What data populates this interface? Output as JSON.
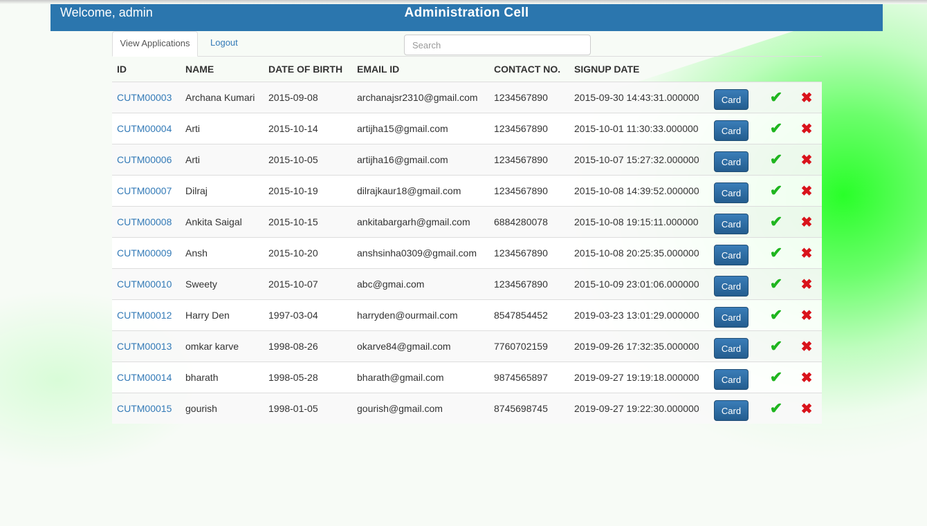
{
  "header": {
    "welcome": "Welcome, admin",
    "title": "Administration Cell",
    "color": "#2b76ae"
  },
  "tabs": [
    {
      "label": "View Applications",
      "active": true
    },
    {
      "label": "Logout",
      "active": false
    }
  ],
  "search": {
    "placeholder": "Search",
    "value": ""
  },
  "table": {
    "columns": [
      "ID",
      "NAME",
      "DATE OF BIRTH",
      "EMAIL ID",
      "CONTACT NO.",
      "SIGNUP DATE"
    ],
    "card_label": "Card",
    "approve_icon": "check-icon",
    "reject_icon": "cross-icon",
    "rows": [
      {
        "id": "CUTM00003",
        "name": "Archana Kumari",
        "dob": "2015-09-08",
        "email": "archanajsr2310@gmail.com",
        "contact": "1234567890",
        "signup": "2015-09-30 14:43:31.000000"
      },
      {
        "id": "CUTM00004",
        "name": "Arti",
        "dob": "2015-10-14",
        "email": "artijha15@gmail.com",
        "contact": "1234567890",
        "signup": "2015-10-01 11:30:33.000000"
      },
      {
        "id": "CUTM00006",
        "name": "Arti",
        "dob": "2015-10-05",
        "email": "artijha16@gmail.com",
        "contact": "1234567890",
        "signup": "2015-10-07 15:27:32.000000"
      },
      {
        "id": "CUTM00007",
        "name": "Dilraj",
        "dob": "2015-10-19",
        "email": "dilrajkaur18@gmail.com",
        "contact": "1234567890",
        "signup": "2015-10-08 14:39:52.000000"
      },
      {
        "id": "CUTM00008",
        "name": "Ankita Saigal",
        "dob": "2015-10-15",
        "email": "ankitabargarh@gmail.com",
        "contact": "6884280078",
        "signup": "2015-10-08 19:15:11.000000"
      },
      {
        "id": "CUTM00009",
        "name": "Ansh",
        "dob": "2015-10-20",
        "email": "anshsinha0309@gmail.com",
        "contact": "1234567890",
        "signup": "2015-10-08 20:25:35.000000"
      },
      {
        "id": "CUTM00010",
        "name": "Sweety",
        "dob": "2015-10-07",
        "email": "abc@gmai.com",
        "contact": "1234567890",
        "signup": "2015-10-09 23:01:06.000000"
      },
      {
        "id": "CUTM00012",
        "name": "Harry Den",
        "dob": "1997-03-04",
        "email": "harryden@ourmail.com",
        "contact": "8547854452",
        "signup": "2019-03-23 13:01:29.000000"
      },
      {
        "id": "CUTM00013",
        "name": "omkar karve",
        "dob": "1998-08-26",
        "email": "okarve84@gmail.com",
        "contact": "7760702159",
        "signup": "2019-09-26 17:32:35.000000"
      },
      {
        "id": "CUTM00014",
        "name": "bharath",
        "dob": "1998-05-28",
        "email": "bharath@gmail.com",
        "contact": "9874565897",
        "signup": "2019-09-27 19:19:18.000000"
      },
      {
        "id": "CUTM00015",
        "name": "gourish",
        "dob": "1998-01-05",
        "email": "gourish@gmail.com",
        "contact": "8745698745",
        "signup": "2019-09-27 19:22:30.000000"
      }
    ]
  }
}
